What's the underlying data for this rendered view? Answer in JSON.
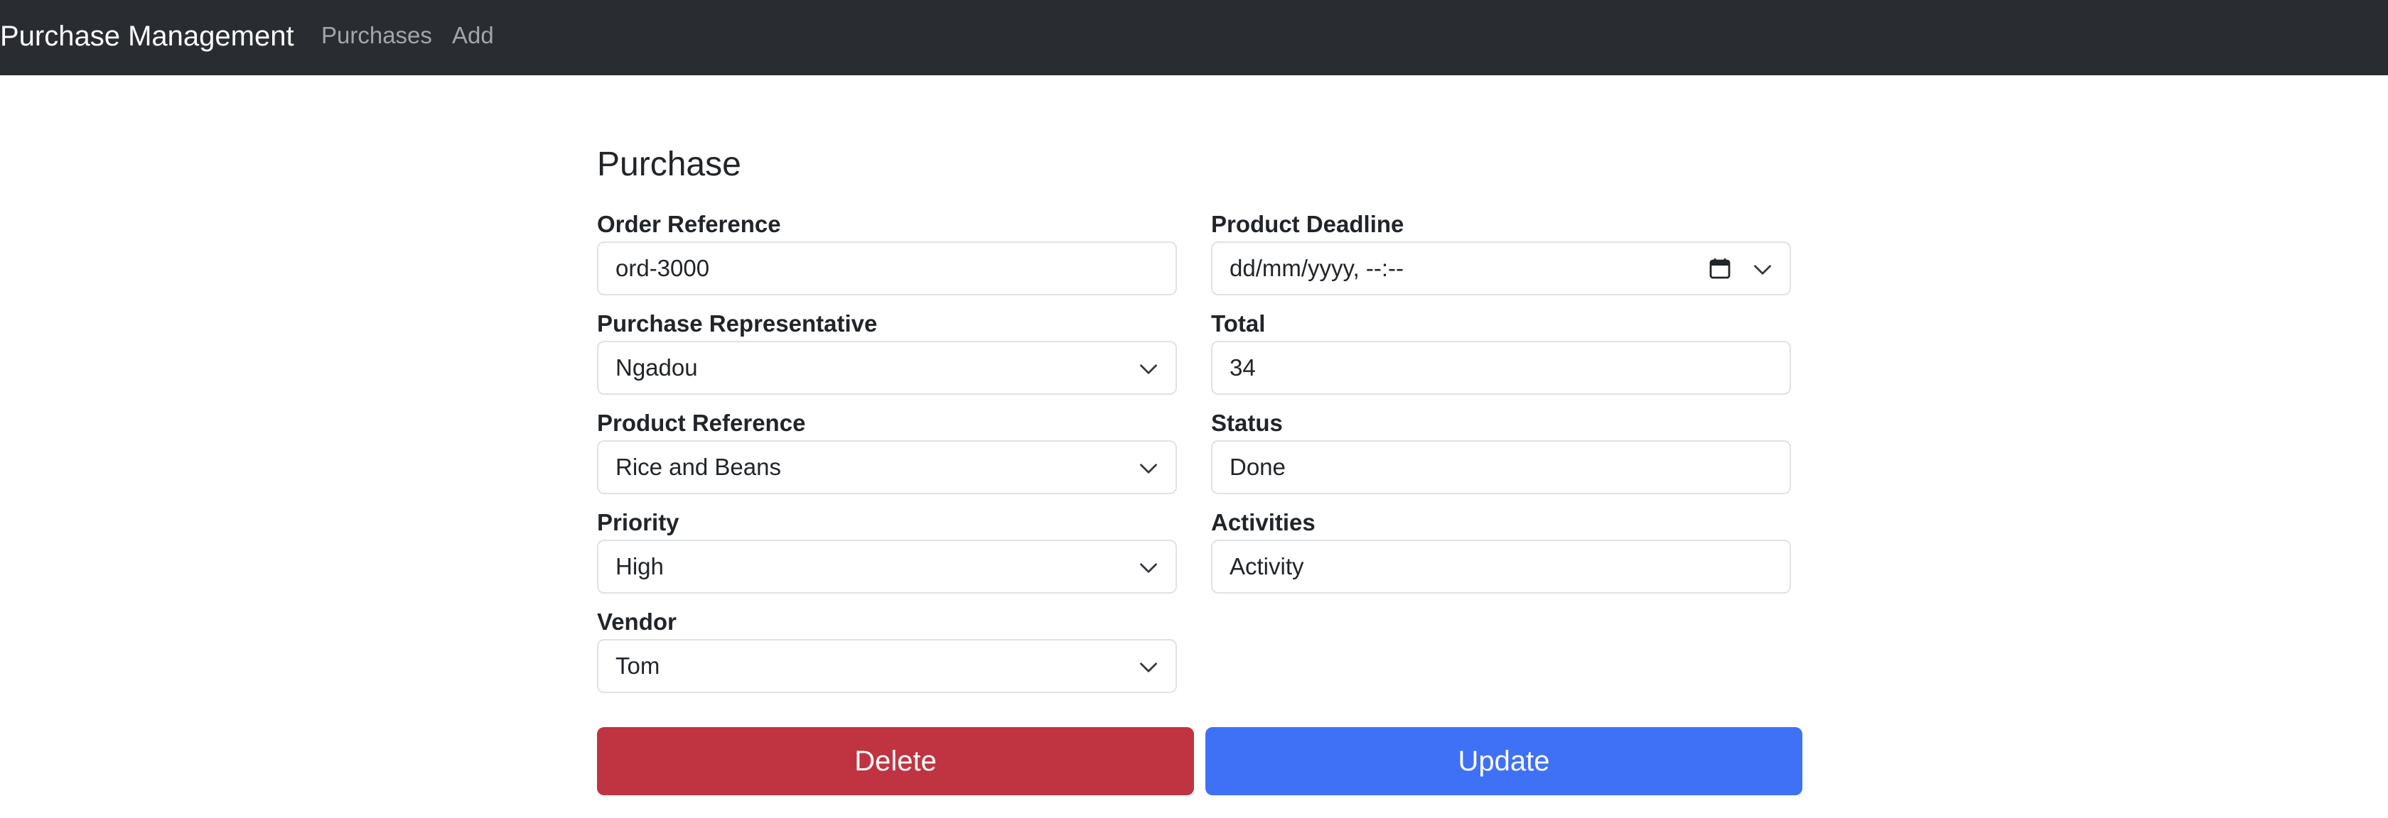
{
  "navbar": {
    "brand": "Purchase Management",
    "links": [
      "Purchases",
      "Add"
    ]
  },
  "form": {
    "title": "Purchase",
    "fields": {
      "order_reference": {
        "label": "Order Reference",
        "value": "ord-3000"
      },
      "purchase_representative": {
        "label": "Purchase Representative",
        "value": "Ngadou"
      },
      "product_reference": {
        "label": "Product Reference",
        "value": "Rice and Beans"
      },
      "priority": {
        "label": "Priority",
        "value": "High"
      },
      "vendor": {
        "label": "Vendor",
        "value": "Tom"
      },
      "product_deadline": {
        "label": "Product Deadline",
        "value": "dd/mm/yyyy, --:--"
      },
      "total": {
        "label": "Total",
        "value": "34"
      },
      "status": {
        "label": "Status",
        "value": "Done"
      },
      "activities": {
        "label": "Activities",
        "value": "Activity"
      }
    },
    "buttons": {
      "delete": "Delete",
      "update": "Update"
    }
  },
  "colors": {
    "navbar_bg": "#292d32",
    "delete_btn": "#c03442",
    "update_btn": "#3f71f6"
  },
  "icons": {
    "select": "chevron-down-icon",
    "date": "calendar-icon"
  }
}
